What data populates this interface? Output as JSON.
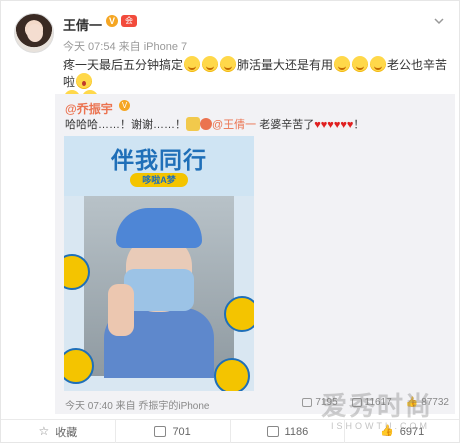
{
  "post": {
    "username": "王倩一",
    "verified_badge": "V",
    "vip_badge": "会",
    "meta": "今天 07:54 来自 iPhone 7",
    "text_part1": "疼一天最后五分钟搞定",
    "text_part2": "肺活量大还是有用",
    "text_part3": "老公也辛苦啦"
  },
  "repost": {
    "username": "@乔振宇",
    "verified_badge": "V",
    "text_part1": "哈哈哈……！谢谢……！",
    "mention": "@王倩一",
    "text_part2": "老婆辛苦了",
    "hearts": "♥♥♥♥♥♥",
    "text_end": "！",
    "photo_title": "伴我同行",
    "photo_subtitle": "哆啦A梦",
    "meta": "今天 07:40 来自 乔振宇的iPhone",
    "stats": {
      "reposts": "7195",
      "comments": "11617",
      "likes": "87732"
    }
  },
  "actions": {
    "favorite": "收藏",
    "repost": "701",
    "comment": "1186",
    "like": "6971"
  },
  "watermark": {
    "main": "爱秀时尚",
    "sub": "ISHOWTU.COM"
  },
  "colors": {
    "name_accent": "#eb7350",
    "heart": "#e02020",
    "repost_bg": "#f2f2f5"
  }
}
